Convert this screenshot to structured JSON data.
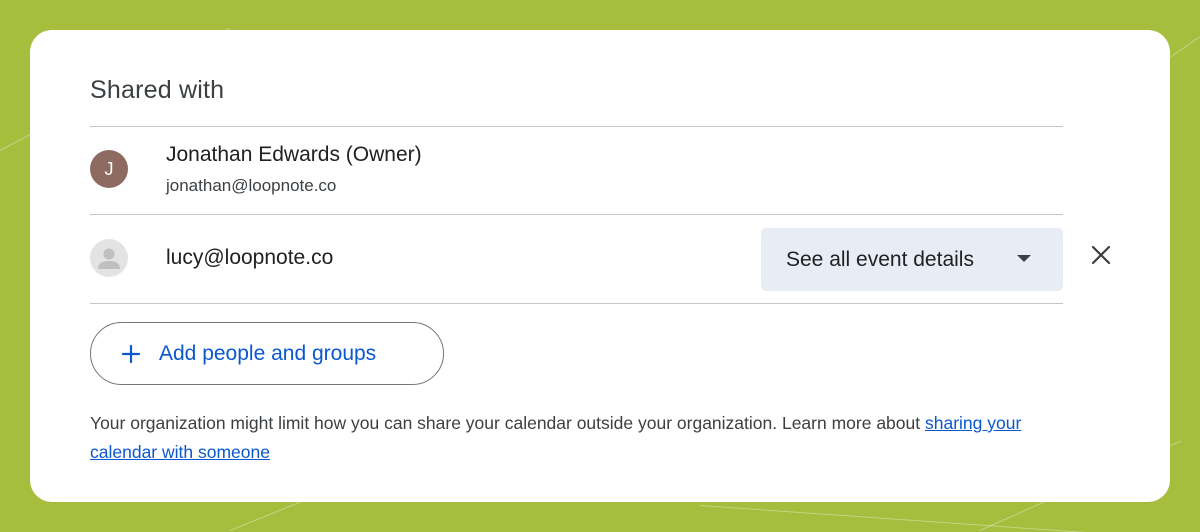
{
  "panel": {
    "title": "Shared with"
  },
  "owner": {
    "avatar_initial": "J",
    "name": "Jonathan Edwards (Owner)",
    "email": "jonathan@loopnote.co",
    "avatar_color": "#8d6b60"
  },
  "guest": {
    "email": "lucy@loopnote.co",
    "permission": "See all event details"
  },
  "actions": {
    "add_label": "Add people and groups"
  },
  "footer": {
    "note_text": "Your organization might limit how you can share your calendar outside your organization. Learn more about ",
    "link_text": "sharing your calendar with someone"
  },
  "colors": {
    "background": "#a6bd3e",
    "accent": "#0b57d0",
    "select_bg": "#e8edf5"
  },
  "icons": {
    "remove": "close-icon",
    "add": "plus-icon",
    "dropdown": "caret-down-icon",
    "guest_avatar": "person-icon"
  }
}
